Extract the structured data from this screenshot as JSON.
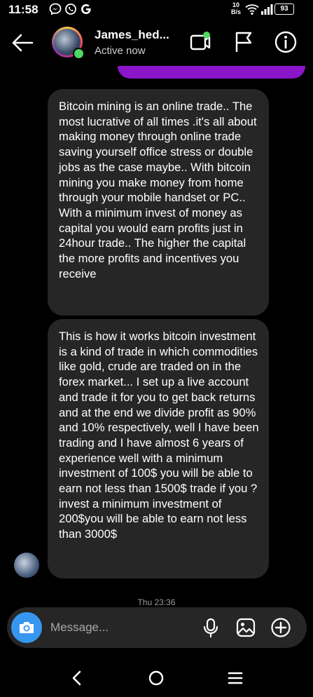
{
  "status_bar": {
    "time": "11:58",
    "net_speed_value": "10",
    "net_speed_unit": "B/s",
    "battery": "93",
    "icons": [
      "messenger-icon",
      "whatsapp-icon",
      "google-icon",
      "wifi-icon",
      "signal-icon",
      "battery-icon"
    ]
  },
  "header": {
    "contact_name": "James_hed...",
    "contact_status": "Active now",
    "icons": [
      "back-arrow-icon",
      "video-call-icon",
      "flag-icon",
      "info-icon"
    ]
  },
  "messages": [
    {
      "sender": "contact",
      "text": "Bitcoin mining is an online trade.. The most lucrative of all times .it's all about making money through online trade saving yourself office stress or double jobs as the case maybe.. With bitcoin mining you make money from home through your mobile handset or PC.. With a minimum invest of money as capital you would earn profits just in 24hour trade.. The higher the capital the more profits and incentives you receive"
    },
    {
      "sender": "contact",
      "text": "This is how it works bitcoin investment is a kind of trade in which commodities like gold, crude are traded on in the forex market... I set up a live account and trade it for you to get back returns and at the end we divide profit as 90% and 10% respectively, well I have been trading and I have almost 6 years of experience well with a minimum investment of 100$ you will be able to earn not less than 1500$ trade if you ?invest a minimum investment of 200$you will be able to earn not less than 3000$"
    }
  ],
  "timestamp": "Thu 23:36",
  "composer": {
    "placeholder": "Message...",
    "icons": [
      "camera-icon",
      "microphone-icon",
      "gallery-icon",
      "add-icon"
    ]
  },
  "colors": {
    "background": "#000000",
    "bubble": "#262626",
    "accent_purple": "#8b15c9",
    "camera_blue": "#3797f0",
    "online_green": "#4cd964"
  }
}
